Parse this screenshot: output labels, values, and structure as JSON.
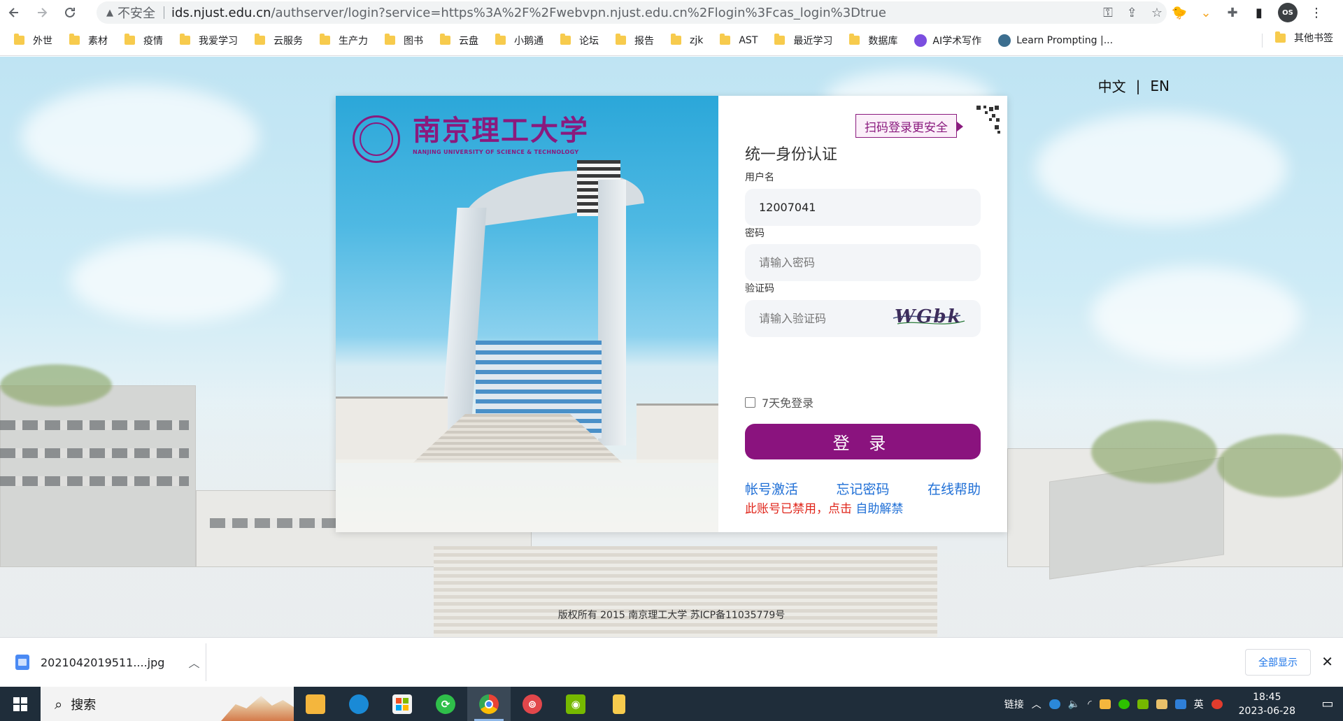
{
  "browser": {
    "security_label": "不安全",
    "url_host": "ids.njust.edu.cn",
    "url_path": "/authserver/login?service=https%3A%2F%2Fwebvpn.njust.edu.cn%2Flogin%3Fcas_login%3Dtrue",
    "avatar_initials": "OS",
    "bookmarks": [
      "外世",
      "素材",
      "疫情",
      "我爱学习",
      "云服务",
      "生产力",
      "图书",
      "云盘",
      "小鹅通",
      "论坛",
      "报告",
      "zjk",
      "AST",
      "最近学习",
      "数据库"
    ],
    "bookmark_ai": "AI学术写作",
    "bookmark_prompt": "Learn Prompting |...",
    "bookmark_other": "其他书签"
  },
  "page": {
    "lang_zh": "中文",
    "lang_sep": "|",
    "lang_en": "EN",
    "logo_cn": "南京理工大学",
    "logo_en": "NANJING UNIVERSITY OF SCIENCE & TECHNOLOGY",
    "qr_tip": "扫码登录更安全",
    "title": "统一身份认证",
    "username_label": "用户名",
    "username_value": "12007041",
    "password_label": "密码",
    "password_placeholder": "请输入密码",
    "captcha_label": "验证码",
    "captcha_placeholder": "请输入验证码",
    "captcha_text": "WGbk",
    "remember_label": "7天免登录",
    "login_button": "登 录",
    "link_activate": "帐号激活",
    "link_forgot": "忘记密码",
    "link_help": "在线帮助",
    "disabled_note": "此账号已禁用，点击",
    "disabled_link": "自助解禁",
    "footer": "版权所有 2015 南京理工大学 苏ICP备11035779号"
  },
  "downloads": {
    "file_name": "2021042019511....jpg",
    "show_all": "全部显示"
  },
  "taskbar": {
    "search_text": "搜索",
    "tray_link": "链接",
    "ime": "英",
    "time": "18:45",
    "date": "2023-06-28"
  },
  "colors": {
    "brand_purple": "#8a137e",
    "link_blue": "#1f6fd6",
    "error_red": "#e0261b"
  }
}
